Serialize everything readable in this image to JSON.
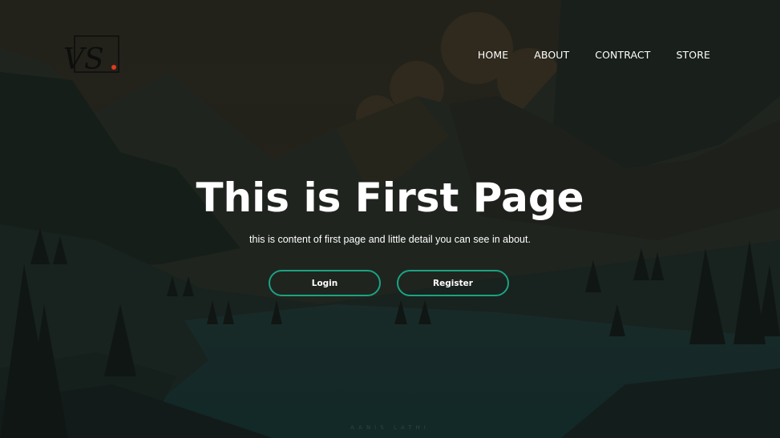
{
  "logo": {
    "text": "VS"
  },
  "nav": {
    "items": [
      {
        "label": "HOME"
      },
      {
        "label": "ABOUT"
      },
      {
        "label": "CONTRACT"
      },
      {
        "label": "STORE"
      }
    ]
  },
  "hero": {
    "title": "This is First Page",
    "subtitle": "this is content of first page and little detail you can see in about.",
    "login_label": "Login",
    "register_label": "Register",
    "accent_color": "#1aa382"
  },
  "watermark": {
    "text": "AANIS LATHI"
  }
}
